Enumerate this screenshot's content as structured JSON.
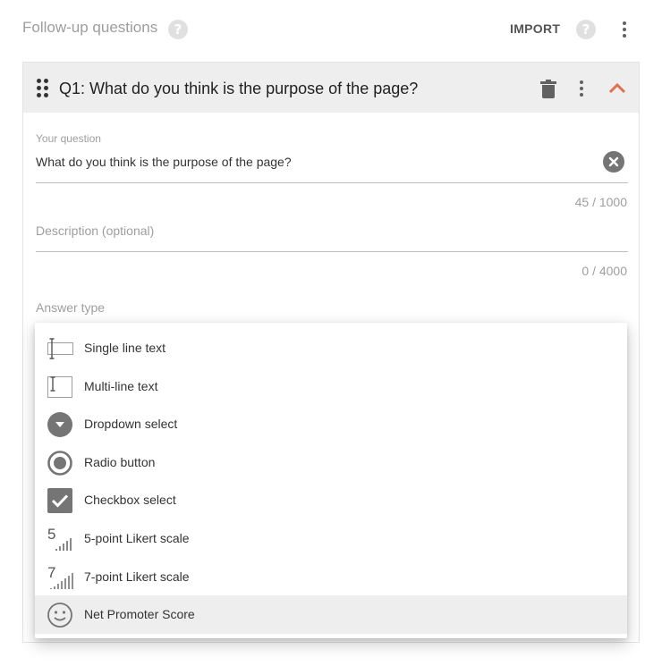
{
  "header": {
    "title": "Follow-up questions",
    "help_glyph": "?",
    "import_label": "IMPORT"
  },
  "question": {
    "title": "Q1: What do you think is the purpose of the page?",
    "question_label": "Your question",
    "question_value": "What do you think is the purpose of the page?",
    "question_counter": "45 / 1000",
    "description_placeholder": "Description (optional)",
    "description_counter": "0 / 4000",
    "answer_type_label": "Answer type"
  },
  "answer_types": [
    {
      "label": "Single line text",
      "icon": "single-line-text-icon"
    },
    {
      "label": "Multi-line text",
      "icon": "multi-line-text-icon"
    },
    {
      "label": "Dropdown select",
      "icon": "dropdown-select-icon"
    },
    {
      "label": "Radio button",
      "icon": "radio-button-icon"
    },
    {
      "label": "Checkbox select",
      "icon": "checkbox-icon"
    },
    {
      "label": "5-point Likert scale",
      "icon": "likert-5-icon",
      "number": "5"
    },
    {
      "label": "7-point Likert scale",
      "icon": "likert-7-icon",
      "number": "7"
    },
    {
      "label": "Net Promoter Score",
      "icon": "smiley-icon",
      "highlighted": true
    }
  ],
  "colors": {
    "accent": "#e0714f",
    "header_bg": "#eeeeee",
    "icon_gray": "#757575",
    "selected_bg": "#eeeeee"
  }
}
